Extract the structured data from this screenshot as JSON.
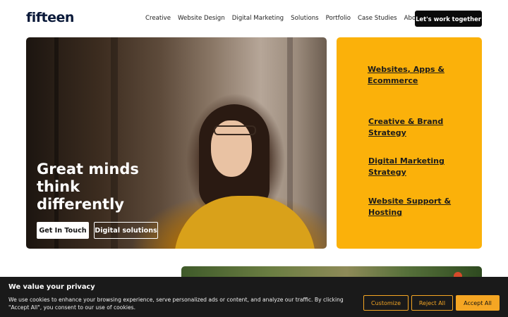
{
  "header": {
    "logo": "fifteen",
    "nav": [
      "Creative",
      "Website Design",
      "Digital Marketing",
      "Solutions",
      "Portfolio",
      "Case Studies",
      "About Us"
    ],
    "cta_label": "Let's work together"
  },
  "hero": {
    "title": "Great minds think differently",
    "primary_button": "Get In Touch",
    "secondary_button": "Digital solutions"
  },
  "panel": {
    "links": [
      {
        "part1": "Websites",
        "sep": ", ",
        "part2": "Apps",
        "rest": " & Ecommerce"
      },
      {
        "label": "Creative & Brand Strategy"
      },
      {
        "label": "Digital Marketing Strategy"
      },
      {
        "label": "Website Support & Hosting"
      }
    ],
    "color": "#fbb10a"
  },
  "cookie": {
    "title": "We value your privacy",
    "text": "We use cookies to enhance your browsing experience, serve personalized ads or content, and analyze our traffic. By clicking \"Accept All\", you consent to our use of cookies.",
    "customize": "Customize",
    "reject": "Reject All",
    "accept": "Accept All",
    "accent": "#f5a623"
  }
}
